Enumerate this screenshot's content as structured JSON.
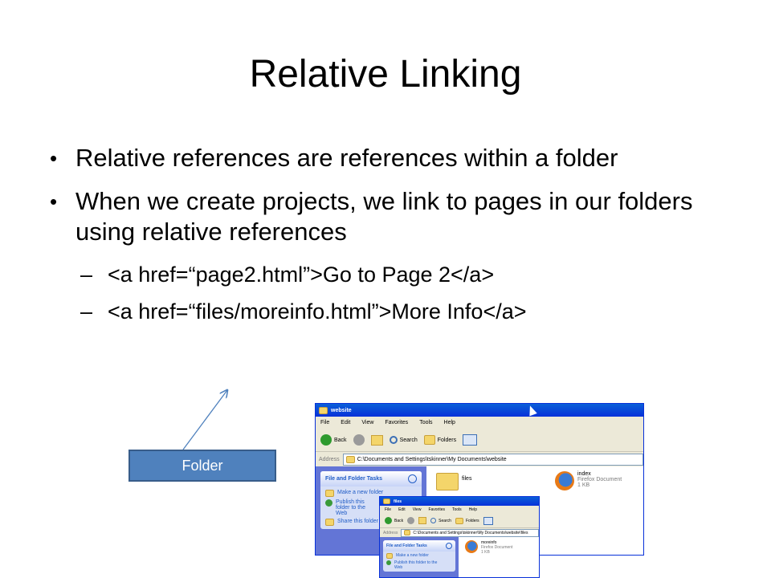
{
  "slide": {
    "title": "Relative Linking",
    "bullets": [
      "Relative references are references within a folder",
      "When we create projects, we link to pages in our folders using relative references"
    ],
    "sub_bullets": [
      "<a href=“page2.html”>Go to Page 2</a>",
      "<a href=“files/moreinfo.html”>More Info</a>"
    ],
    "bullet_glyph": "•",
    "dash_glyph": "–",
    "callout_label": "Folder"
  },
  "window1": {
    "title": "website",
    "menu": [
      "File",
      "Edit",
      "View",
      "Favorites",
      "Tools",
      "Help"
    ],
    "toolbar": {
      "back": "Back",
      "search": "Search",
      "folders": "Folders"
    },
    "address_label": "Address",
    "address": "C:\\Documents and Settings\\tskinner\\My Documents\\website",
    "tasks_header": "File and Folder Tasks",
    "tasks": [
      "Make a new folder",
      "Publish this folder to the Web",
      "Share this folder"
    ],
    "items": [
      {
        "name": "files"
      },
      {
        "name": "index",
        "type": "Firefox Document",
        "size": "1 KB"
      }
    ]
  },
  "window2": {
    "title": "files",
    "menu": [
      "File",
      "Edit",
      "View",
      "Favorites",
      "Tools",
      "Help"
    ],
    "toolbar": {
      "back": "Back",
      "search": "Search",
      "folders": "Folders"
    },
    "address_label": "Address",
    "address": "C:\\Documents and Settings\\tskinner\\My Documents\\website\\files",
    "tasks_header": "File and Folder Tasks",
    "tasks": [
      "Make a new folder",
      "Publish this folder to the Web"
    ],
    "items": [
      {
        "name": "moreinfo",
        "type": "Firefox Document",
        "size": "1 KB"
      }
    ]
  },
  "colors": {
    "accent": "#4f81bd",
    "xp_blue": "#0831d9",
    "task_blue": "#6375d6"
  }
}
